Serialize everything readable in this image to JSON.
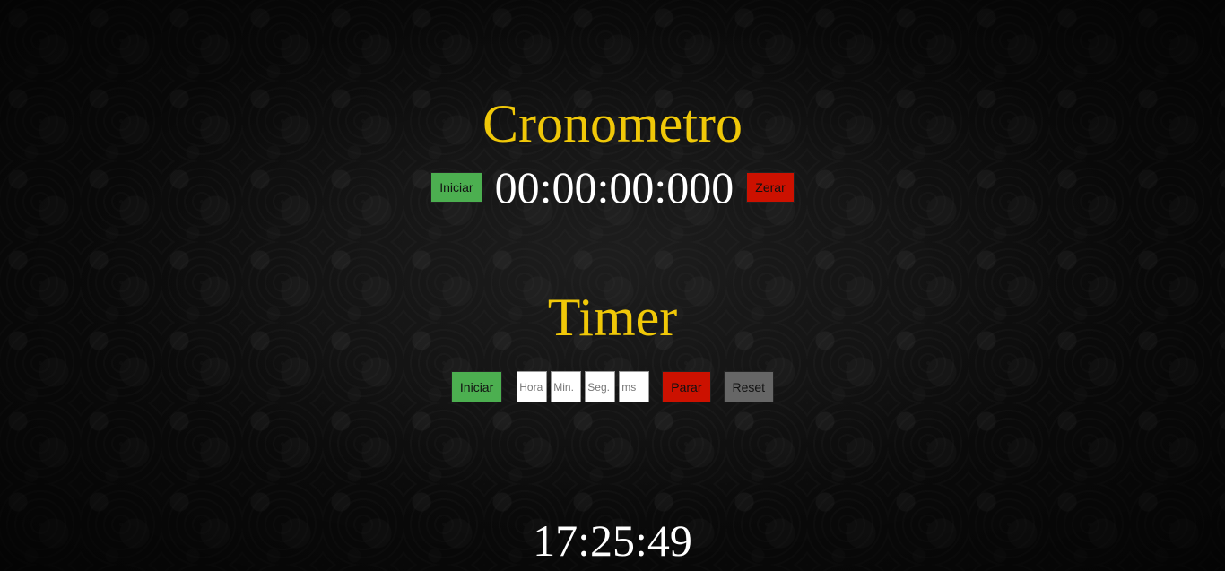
{
  "stopwatch": {
    "title": "Cronometro",
    "start_label": "Iniciar",
    "display": "00:00:00:000",
    "reset_label": "Zerar"
  },
  "timer": {
    "title": "Timer",
    "start_label": "Iniciar",
    "hours_placeholder": "Hora",
    "minutes_placeholder": "Min.",
    "seconds_placeholder": "Seg.",
    "ms_placeholder": "ms",
    "stop_label": "Parar",
    "reset_label": "Reset"
  },
  "clock": {
    "time": "17:25:49"
  },
  "colors": {
    "title": "#f0c808",
    "green_button": "#4caf50",
    "red_button": "#cc1100",
    "gray_button": "#666666"
  }
}
